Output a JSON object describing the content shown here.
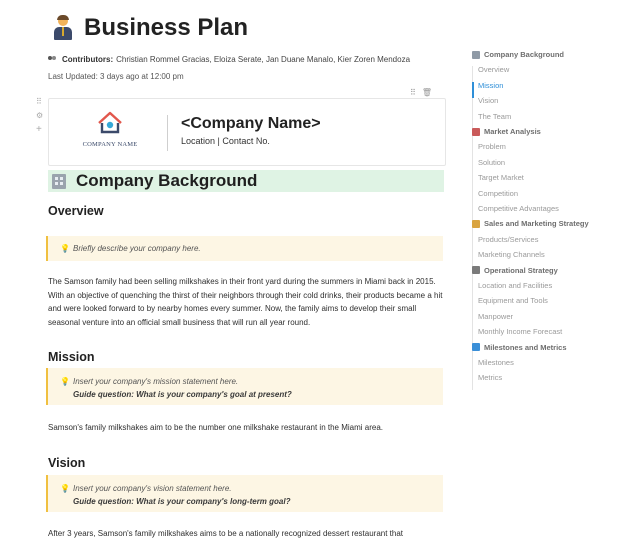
{
  "document": {
    "title": "Business Plan",
    "title_icon": "businessman-icon",
    "contributors_label": "Contributors:",
    "contributors": "Christian Rommel Gracias, Eloiza Serate, Jan Duane Manalo, Kier Zoren Mendoza",
    "last_updated": "Last Updated: 3 days ago at 12:00 pm"
  },
  "company_card": {
    "logo_text": "COMPANY NAME",
    "name": "<Company Name>",
    "contact": "Location | Contact No."
  },
  "sections": {
    "banner_title": "Company Background",
    "overview": {
      "heading": "Overview",
      "callout": "Briefly describe your company here.",
      "body": "The Samson family had been selling milkshakes in their front yard during the summers in Miami back in 2015. With an objective of quenching the thirst of their neighbors through their cold drinks, their products became a hit and were looked forward to by nearby homes every summer. Now, the family aims to develop their small seasonal venture into an official small business that will run all year round."
    },
    "mission": {
      "heading": "Mission",
      "callout": "Insert your company's mission statement here.",
      "guide": "Guide question: What is your company's goal at present?",
      "body": "Samson's family milkshakes aim to be the number one milkshake restaurant in the Miami area."
    },
    "vision": {
      "heading": "Vision",
      "callout": "Insert your company's vision statement here.",
      "guide": "Guide question: What is your company's long-term goal?",
      "body": "After 3 years, Samson's family milkshakes aims to be a nationally recognized dessert restaurant that"
    }
  },
  "toc": {
    "items": [
      {
        "label": "Company Background",
        "type": "head",
        "icon": "building-icon",
        "color": "#8f9aa6"
      },
      {
        "label": "Overview",
        "type": "sub"
      },
      {
        "label": "Mission",
        "type": "sub",
        "active": true
      },
      {
        "label": "Vision",
        "type": "sub"
      },
      {
        "label": "The Team",
        "type": "sub"
      },
      {
        "label": "Market Analysis",
        "type": "head",
        "icon": "chart-icon",
        "color": "#c95a5a"
      },
      {
        "label": "Problem",
        "type": "sub"
      },
      {
        "label": "Solution",
        "type": "sub"
      },
      {
        "label": "Target Market",
        "type": "sub"
      },
      {
        "label": "Competition",
        "type": "sub"
      },
      {
        "label": "Competitive Advantages",
        "type": "sub"
      },
      {
        "label": "Sales and Marketing Strategy",
        "type": "head",
        "icon": "megaphone-icon",
        "color": "#d9a441"
      },
      {
        "label": "Products/Services",
        "type": "sub"
      },
      {
        "label": "Marketing Channels",
        "type": "sub"
      },
      {
        "label": "Operational Strategy",
        "type": "head",
        "icon": "gear-icon",
        "color": "#7a7a7a"
      },
      {
        "label": "Location and Facilities",
        "type": "sub"
      },
      {
        "label": "Equipment and Tools",
        "type": "sub"
      },
      {
        "label": "Manpower",
        "type": "sub"
      },
      {
        "label": "Monthly Income Forecast",
        "type": "sub"
      },
      {
        "label": "Milestones and Metrics",
        "type": "head",
        "icon": "diamond-icon",
        "color": "#3a8fd8"
      },
      {
        "label": "Milestones",
        "type": "sub"
      },
      {
        "label": "Metrics",
        "type": "sub"
      }
    ]
  },
  "colors": {
    "accent": "#2f8fd8",
    "banner_bg": "#dff3e4",
    "callout_bg": "#fdf6e4",
    "callout_border": "#f0c040"
  }
}
